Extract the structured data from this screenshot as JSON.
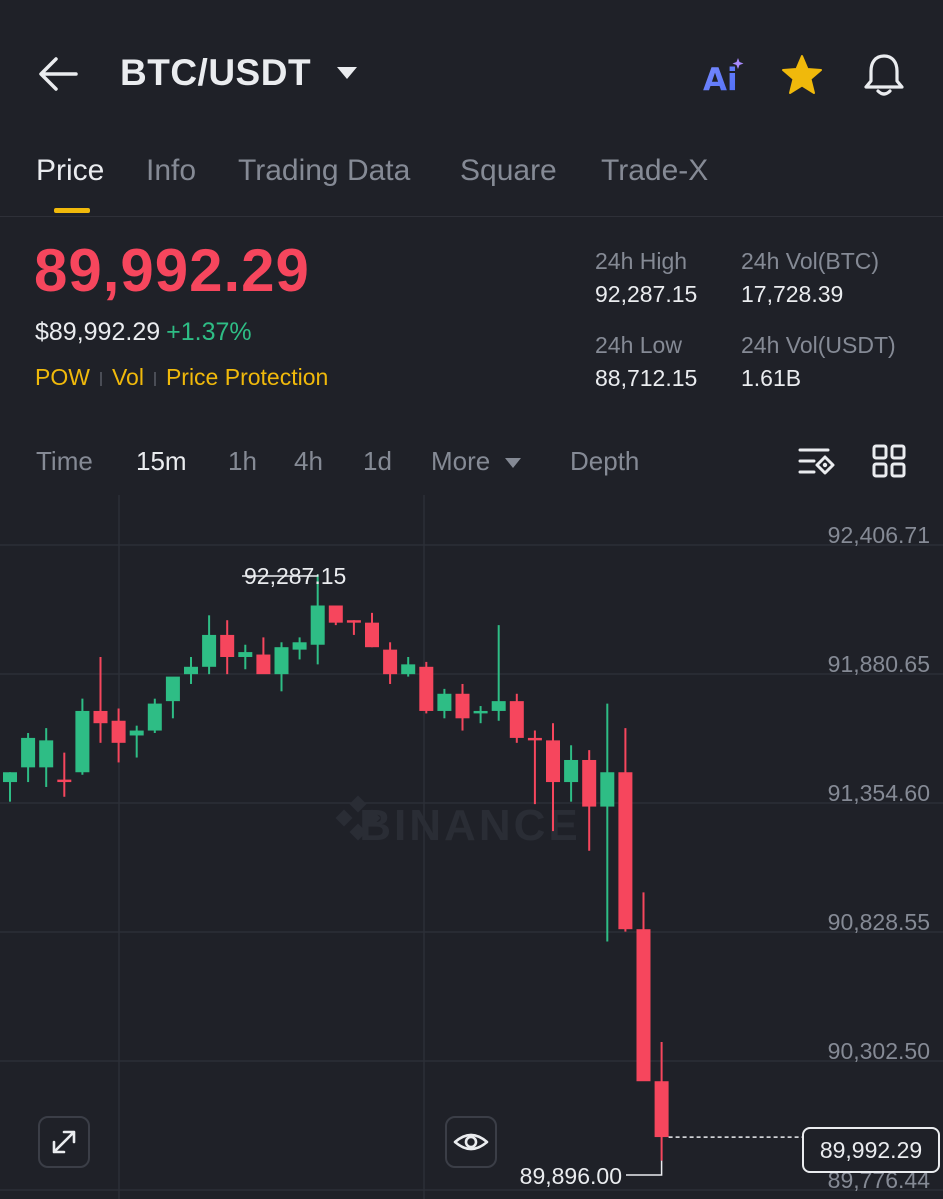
{
  "header": {
    "pair": "BTC/USDT",
    "ai_label": "Ai"
  },
  "tabs": [
    "Price",
    "Info",
    "Trading Data",
    "Square",
    "Trade-X"
  ],
  "price": {
    "last": "89,992.29",
    "fiat": "$89,992.29",
    "change": "+1.37%"
  },
  "tags": [
    "POW",
    "Vol",
    "Price Protection"
  ],
  "stats": {
    "high_label": "24h High",
    "high_value": "92,287.15",
    "vol_btc_label": "24h Vol(BTC)",
    "vol_btc_value": "17,728.39",
    "low_label": "24h Low",
    "low_value": "88,712.15",
    "vol_usdt_label": "24h Vol(USDT)",
    "vol_usdt_value": "1.61B"
  },
  "timeframes": {
    "time": "Time",
    "m15": "15m",
    "h1": "1h",
    "h4": "4h",
    "d1": "1d",
    "more": "More",
    "depth": "Depth"
  },
  "colors": {
    "up": "#2ebd85",
    "down": "#f6465d",
    "accent": "#f0b90b",
    "bg": "#1f2128"
  },
  "chart_data": {
    "type": "candlestick",
    "interval": "15m",
    "watermark": "BINANCE",
    "y_ticks": [
      "92,406.71",
      "91,880.65",
      "91,354.60",
      "90,828.55",
      "90,302.50",
      "89,776.44"
    ],
    "ylim": [
      89776.44,
      92406.71
    ],
    "annotations": {
      "high": "92,287.15",
      "low": "89,896.00",
      "last": "89,992.29"
    },
    "candles": [
      {
        "o": 91440,
        "h": 91480,
        "l": 91360,
        "c": 91480
      },
      {
        "o": 91500,
        "h": 91640,
        "l": 91440,
        "c": 91620
      },
      {
        "o": 91500,
        "h": 91660,
        "l": 91420,
        "c": 91610
      },
      {
        "o": 91450,
        "h": 91560,
        "l": 91380,
        "c": 91440
      },
      {
        "o": 91480,
        "h": 91780,
        "l": 91470,
        "c": 91730
      },
      {
        "o": 91730,
        "h": 91950,
        "l": 91600,
        "c": 91680
      },
      {
        "o": 91690,
        "h": 91740,
        "l": 91520,
        "c": 91600
      },
      {
        "o": 91630,
        "h": 91670,
        "l": 91540,
        "c": 91650
      },
      {
        "o": 91650,
        "h": 91780,
        "l": 91640,
        "c": 91760
      },
      {
        "o": 91770,
        "h": 91830,
        "l": 91700,
        "c": 91870
      },
      {
        "o": 91880,
        "h": 91950,
        "l": 91840,
        "c": 91910
      },
      {
        "o": 91910,
        "h": 92120,
        "l": 91880,
        "c": 92040
      },
      {
        "o": 92040,
        "h": 92100,
        "l": 91880,
        "c": 91950
      },
      {
        "o": 91950,
        "h": 92000,
        "l": 91900,
        "c": 91970
      },
      {
        "o": 91960,
        "h": 92030,
        "l": 91890,
        "c": 91880
      },
      {
        "o": 91880,
        "h": 92010,
        "l": 91810,
        "c": 91990
      },
      {
        "o": 91980,
        "h": 92030,
        "l": 91940,
        "c": 92010
      },
      {
        "o": 92000,
        "h": 92287.15,
        "l": 91920,
        "c": 92160
      },
      {
        "o": 92160,
        "h": 92160,
        "l": 92080,
        "c": 92090
      },
      {
        "o": 92100,
        "h": 92100,
        "l": 92040,
        "c": 92090
      },
      {
        "o": 92090,
        "h": 92130,
        "l": 91990,
        "c": 91990
      },
      {
        "o": 91980,
        "h": 92010,
        "l": 91840,
        "c": 91880
      },
      {
        "o": 91880,
        "h": 91950,
        "l": 91870,
        "c": 91920
      },
      {
        "o": 91910,
        "h": 91930,
        "l": 91720,
        "c": 91730
      },
      {
        "o": 91730,
        "h": 91820,
        "l": 91700,
        "c": 91800
      },
      {
        "o": 91800,
        "h": 91840,
        "l": 91650,
        "c": 91700
      },
      {
        "o": 91720,
        "h": 91750,
        "l": 91680,
        "c": 91730
      },
      {
        "o": 91730,
        "h": 92080,
        "l": 91690,
        "c": 91770
      },
      {
        "o": 91770,
        "h": 91800,
        "l": 91600,
        "c": 91620
      },
      {
        "o": 91620,
        "h": 91650,
        "l": 91350,
        "c": 91610
      },
      {
        "o": 91610,
        "h": 91680,
        "l": 91240,
        "c": 91440
      },
      {
        "o": 91440,
        "h": 91590,
        "l": 91360,
        "c": 91530
      },
      {
        "o": 91530,
        "h": 91570,
        "l": 91160,
        "c": 91340
      },
      {
        "o": 91340,
        "h": 91760,
        "l": 90790,
        "c": 91480
      },
      {
        "o": 91480,
        "h": 91660,
        "l": 90830,
        "c": 90840
      },
      {
        "o": 90840,
        "h": 90990,
        "l": 90300,
        "c": 90220
      },
      {
        "o": 90220,
        "h": 90380,
        "l": 89896.0,
        "c": 89992.29
      }
    ]
  }
}
